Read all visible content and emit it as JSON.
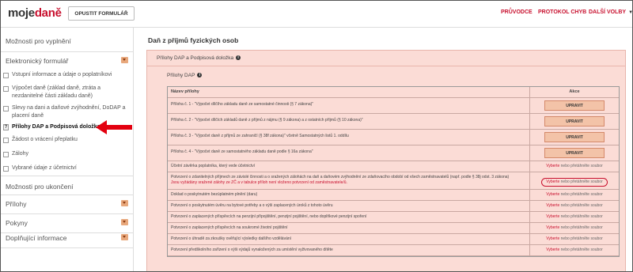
{
  "header": {
    "logo_moje": "moje",
    "logo_dane": "daně",
    "close_button": "OPUSTIT FORMULÁŘ",
    "nav": {
      "pruvodce": "PRŮVODCE",
      "protokol": "PROTOKOL CHYB",
      "dalsi": "DALŠÍ VOLBY"
    }
  },
  "sidebar": {
    "moznosti_vyplneni": "Možnosti pro vyplnění",
    "elektronicky": "Elektronický formulář",
    "items": [
      {
        "label": "Vstupní informace a údaje o poplatníkovi"
      },
      {
        "label": "Výpočet daně (základ daně, ztráta a nezdanitelné části základu daně)"
      },
      {
        "label": "Slevy na dani a daňové zvýhodnění, DoDAP a placení daně"
      },
      {
        "label": "Přílohy DAP a Podpisová doložka"
      },
      {
        "label": "Žádost o vrácení přeplatku"
      },
      {
        "label": "Zálohy"
      },
      {
        "label": "Vybrané údaje z účetnictví"
      }
    ],
    "moznosti_ukonceni": "Možnosti pro ukončení",
    "prilohy": "Přílohy",
    "pokyny": "Pokyny",
    "doplnujici": "Doplňující informace"
  },
  "main": {
    "title": "Daň z příjmů fyzických osob",
    "panel_title": "Přílohy DAP a Podpisová doložka",
    "sub_title": "Přílohy DAP",
    "table": {
      "col_name": "Název přílohy",
      "col_action": "Akce",
      "upravit_label": "UPRAVIT",
      "select_label": "Vyberte",
      "drag_label": "nebo přetáhněte soubor",
      "rows": [
        {
          "name": "Příloha č. 1 - \"Výpočet dílčího základu daně ze samostatné činnosti (§ 7 zákona)\""
        },
        {
          "name": "Příloha č. 2 - \"Výpočet dílčích základů daně z příjmů z nájmu (§ 9 zákona) a z ostatních příjmů (§ 10 zákona)\""
        },
        {
          "name": "Příloha č. 3 - \"Výpočet daně z příjmů ze zahraničí (§ 38f zákona)\" včetně Samostatných listů 1. oddílu"
        },
        {
          "name": "Příloha č. 4 - \"Výpočet daně ze samostatného základu daně podle § 16a zákona\""
        },
        {
          "name": "Účetní závěrka poplatníka, který vede účetnictví"
        },
        {
          "name": "Potvrzení o zdanitelných příjmech ze závislé činnosti a o sražených zálohách na daň a daňovém zvýhodnění ze zdaňovacího období od všech zaměstnavatelů (např. podle § 38j odst. 3 zákona)",
          "note": "Jsou vyžádány sražené zálohy ze ZČ a v tabulce příloh není vloženo potvrzení od zaměstnavatele/ů."
        },
        {
          "name": "Doklad o poskytnutém bezúplatném plnění (daru)"
        },
        {
          "name": "Potvrzení o poskytnutém úvěru na bytové potřeby a o výši zaplacených úroků z tohoto úvěru"
        },
        {
          "name": "Potvrzení o zaplacených příspěvcích na penzijní připojištění, penzijní pojištění, nebo doplňkové penzijní spoření"
        },
        {
          "name": "Potvrzení o zaplacených příspěvcích na soukromé životní pojištění"
        },
        {
          "name": "Potvrzení o úhradě za zkoušky ověřující výsledky dalšího vzdělávání"
        },
        {
          "name": "Potvrzení předškolního zařízení o výši výdajů vynaložených za umístění vyživovaného dítěte"
        }
      ]
    }
  },
  "colors": {
    "brand_red": "#c8102e",
    "panel_bg": "#fbdcd6",
    "toggle_bg": "#e8a87c"
  }
}
